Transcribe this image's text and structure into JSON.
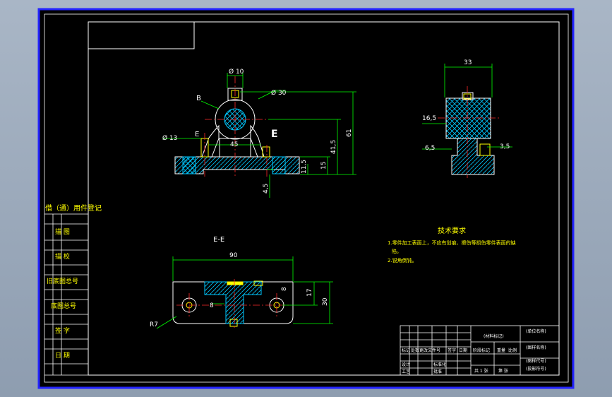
{
  "colors": {
    "background": "#000000",
    "frame": "#2424ff",
    "border": "#ffffff",
    "outline": "#ffffff",
    "dimension": "#00ff00",
    "hatch": "#00c8ff",
    "centerline": "#ff2a2a",
    "section_fill": "#ffff00",
    "text_yellow": "#ffff00",
    "text_white": "#ffffff"
  },
  "front_view": {
    "label_b": "B",
    "label_e": "E",
    "label_e_big": "E",
    "dim_phi10": "Ø 10",
    "dim_phi30": "Ø 30",
    "dim_phi13": "Ø 13",
    "dim_45": "45",
    "dim_61": "61",
    "dim_41_5": "41,5",
    "dim_15": "15",
    "dim_11_5": "11,5",
    "dim_4_5": "4,5"
  },
  "side_view": {
    "dim_33": "33",
    "dim_16_5": "16,5",
    "dim_6_5": "6,5",
    "dim_3_5": "3,5"
  },
  "section_view": {
    "title": "E-E",
    "dim_90": "90",
    "dim_8a": "8",
    "dim_8b": "8",
    "dim_17": "17",
    "dim_30": "30",
    "dim_r7": "R7"
  },
  "tech_requirements": {
    "heading": "技术要求",
    "line1": "1.零件加工表面上，不应有划痕、擦伤等损伤零件表面的缺",
    "line1b": "陷。",
    "line2": "2.锐角倒钝。"
  },
  "side_register": {
    "title": "借（通）用件登记",
    "rows": [
      "描 图",
      "描 校",
      "旧底图总号",
      "底图总号",
      "签 字",
      "日 期"
    ]
  },
  "title_block": {
    "cells": [
      {
        "text": "(材料标记)"
      },
      {
        "text": "(单位名称)"
      },
      {
        "text": "(图样名称)"
      },
      {
        "text": "(图样代号)"
      },
      {
        "text": "(投影符号)"
      },
      {
        "text": "标记"
      },
      {
        "text": "处数"
      },
      {
        "text": "更改文件号"
      },
      {
        "text": "签字"
      },
      {
        "text": "日期"
      },
      {
        "text": "阶段标记"
      },
      {
        "text": "重量"
      },
      {
        "text": "比例"
      },
      {
        "text": "设计"
      },
      {
        "text": "工艺"
      },
      {
        "text": "标准化"
      },
      {
        "text": "批准"
      },
      {
        "text": "共 1 张"
      },
      {
        "text": "第 张"
      }
    ]
  }
}
